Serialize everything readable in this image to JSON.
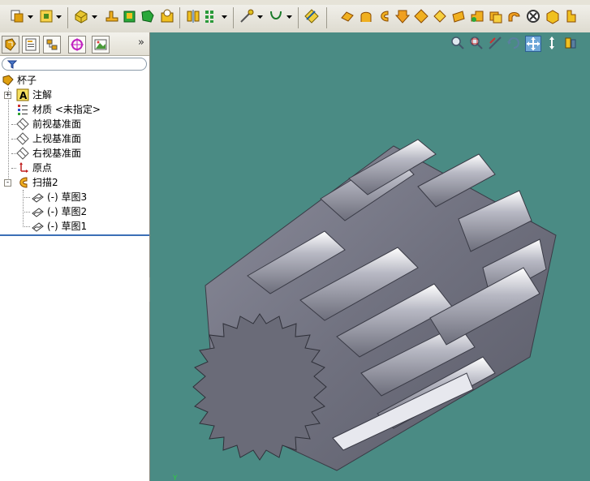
{
  "toolbar": {
    "buttons": [
      {
        "name": "new-sketch-icon",
        "color": "#e0a010"
      },
      {
        "name": "sketch-entities-icon",
        "color": "#e0a010"
      },
      {
        "name": "extrude-boss-icon",
        "color": "#e0c020"
      },
      {
        "name": "revolve-icon",
        "color": "#e0a010"
      },
      {
        "name": "extrude-cut-icon",
        "color": "#1a9e2a"
      },
      {
        "name": "revolve-cut-icon",
        "color": "#1a9e2a"
      },
      {
        "name": "fillet-icon",
        "color": "#e0a010"
      },
      {
        "name": "mirror-icon",
        "color": "#e0a010"
      },
      {
        "name": "linear-pattern-icon",
        "color": "#1a7a2a"
      },
      {
        "name": "reference-geometry-icon",
        "color": "#7a7a7a"
      },
      {
        "name": "curves-icon",
        "color": "#1a7a2a"
      },
      {
        "name": "measure-icon",
        "color": "#2060a0"
      },
      {
        "name": "extruded-surface-icon",
        "color": "#e0a010"
      },
      {
        "name": "revolved-surface-icon",
        "color": "#e0a010"
      },
      {
        "name": "swept-surface-icon",
        "color": "#e0a010"
      },
      {
        "name": "lofted-surface-icon",
        "color": "#e08010"
      },
      {
        "name": "boundary-surface-icon",
        "color": "#e0a010"
      },
      {
        "name": "filled-surface-icon",
        "color": "#e0a010"
      },
      {
        "name": "planar-surface-icon",
        "color": "#e0a010"
      },
      {
        "name": "offset-surface-icon",
        "color": "#1a9e2a"
      },
      {
        "name": "ruled-surface-icon",
        "color": "#e0a010"
      },
      {
        "name": "knit-surface-icon",
        "color": "#e0a010"
      },
      {
        "name": "delete-face-icon",
        "color": "#303030"
      },
      {
        "name": "thicken-icon",
        "color": "#e0a010"
      },
      {
        "name": "trim-surface-icon",
        "color": "#e0a010"
      }
    ]
  },
  "panel": {
    "tabs": [
      "feature-manager-icon",
      "property-manager-icon",
      "configuration-manager-icon",
      "dimxpert-icon",
      "display-manager-icon"
    ],
    "more_label": "»"
  },
  "tree": {
    "root": "杯子",
    "items": [
      {
        "label": "注解",
        "icon": "annotations-icon",
        "expander": "+"
      },
      {
        "label": "材质 <未指定>",
        "icon": "material-icon",
        "expander": ""
      },
      {
        "label": "前视基准面",
        "icon": "plane-icon",
        "expander": ""
      },
      {
        "label": "上视基准面",
        "icon": "plane-icon",
        "expander": ""
      },
      {
        "label": "右视基准面",
        "icon": "plane-icon",
        "expander": ""
      },
      {
        "label": "原点",
        "icon": "origin-icon",
        "expander": ""
      },
      {
        "label": "扫描2",
        "icon": "sweep-icon",
        "expander": "-"
      }
    ],
    "children": [
      {
        "label": "(-) 草图3",
        "icon": "sketch-icon"
      },
      {
        "label": "(-) 草图2",
        "icon": "sketch-icon"
      },
      {
        "label": "(-) 草图1",
        "icon": "sketch-icon"
      }
    ]
  },
  "viewport": {
    "background": "#4a8b84",
    "tools": [
      "zoom-to-fit-icon",
      "zoom-to-area-icon",
      "previous-view-icon",
      "rotate-view-icon",
      "pan-icon",
      "zoom-in-out-icon",
      "section-view-icon"
    ],
    "active_tool": "pan-icon"
  }
}
